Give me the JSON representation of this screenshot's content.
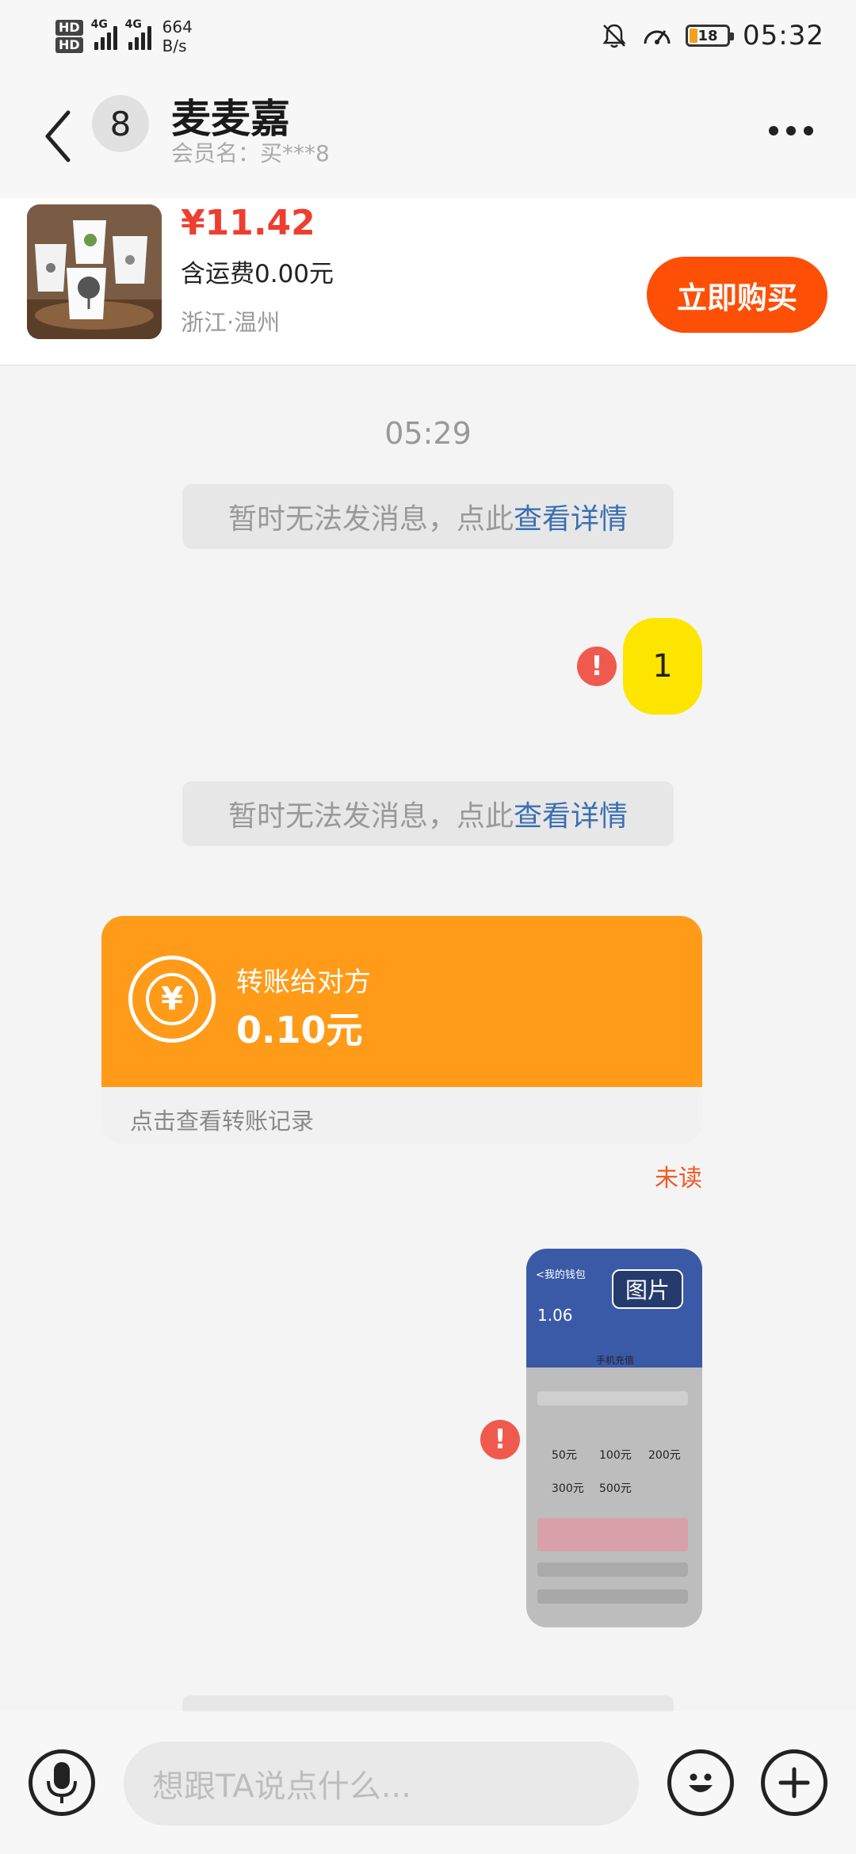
{
  "status_bar": {
    "hd1": "HD",
    "hd2": "HD",
    "net1": "4G",
    "net2": "4G",
    "speed_value": "664",
    "speed_unit": "B/s",
    "battery_level": "18",
    "battery_color": "#f2a020",
    "time": "05:32"
  },
  "header": {
    "unread_count": "8",
    "name": "麦麦嘉",
    "member_label": "会员名：买***8"
  },
  "product": {
    "price": "¥11.42",
    "shipping": "含运费0.00元",
    "location": "浙江·温州",
    "buy_label": "立即购买",
    "buy_color": "#fe4f06"
  },
  "chat": {
    "timestamp": "05:29",
    "system_prefix": "暂时无法发消息，点此",
    "system_link": "查看详情",
    "message_text": "1",
    "error_mark": "!",
    "transfer": {
      "title": "转账给对方",
      "amount": "0.10元",
      "footer": "点击查看转账记录",
      "icon_symbol": "¥"
    },
    "unread_label": "未读",
    "image_tag": "图片",
    "image_screenshot": {
      "title": "<我的钱包",
      "balance": "1.06",
      "page_title": "手机充值",
      "amounts": [
        "50元",
        "100元",
        "200元",
        "300元",
        "500元"
      ]
    }
  },
  "input_bar": {
    "placeholder": "想跟TA说点什么..."
  }
}
